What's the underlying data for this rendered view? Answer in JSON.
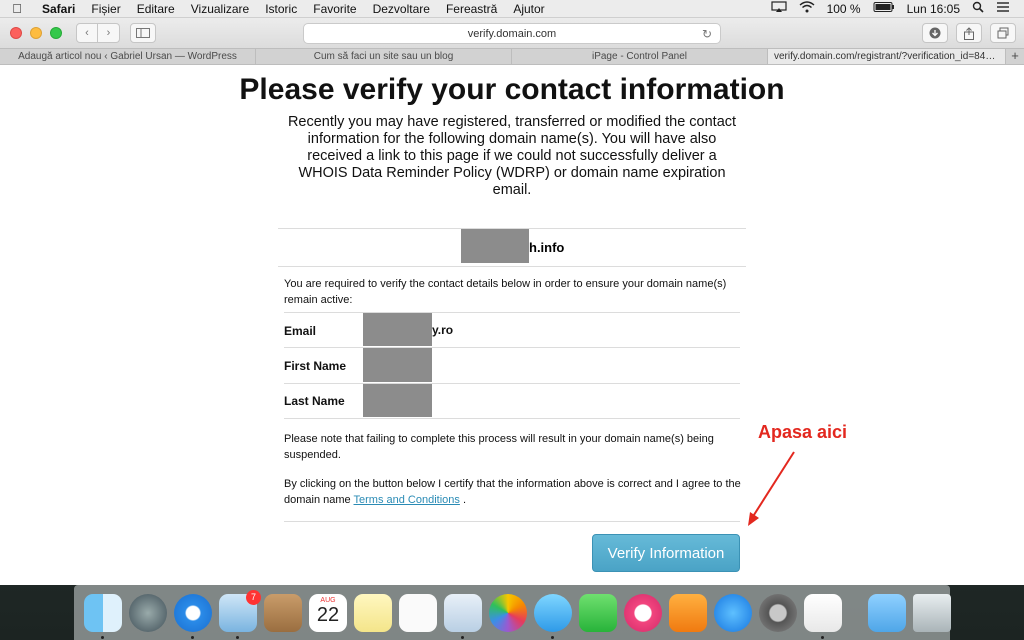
{
  "menubar": {
    "app": "Safari",
    "items": [
      "Fișier",
      "Editare",
      "Vizualizare",
      "Istoric",
      "Favorite",
      "Dezvoltare",
      "Fereastră",
      "Ajutor"
    ],
    "battery": "100 %",
    "clock": "Lun 16:05"
  },
  "browser": {
    "url": "verify.domain.com",
    "tabs": [
      "Adaugă articol nou ‹ Gabriel Ursan — WordPress",
      "Cum să faci un site sau un blog",
      "iPage - Control Panel",
      "verify.domain.com/registrant/?verification_id=842..."
    ],
    "new_tab": "+"
  },
  "page": {
    "title": "Please verify your contact information",
    "intro": "Recently you may have registered, transferred or modified the contact information for the following domain name(s). You will have also received a link to this page if we could not successfully deliver a WHOIS Data Reminder Policy (WDRP) or domain name expiration email.",
    "domain_suffix": "h.info",
    "required_text": "You are required to verify the contact details below in order to ensure your domain name(s) remain active:",
    "fields": {
      "email_label": "Email",
      "email_suffix": "y.ro",
      "first_name_label": "First Name",
      "last_name_label": "Last Name"
    },
    "note": "Please note that failing to complete this process will result in your domain name(s) being suspended.",
    "certify_prefix": "By clicking on the button below I certify that the information above is correct and I agree to the domain name",
    "terms_link": "Terms and Conditions",
    "certify_suffix": ".",
    "verify_button": "Verify Information"
  },
  "annotation": {
    "text": "Apasa aici",
    "color": "#e3281f"
  },
  "dock": {
    "calendar_month": "AUG",
    "calendar_day": "22",
    "mail_badge": "7"
  }
}
